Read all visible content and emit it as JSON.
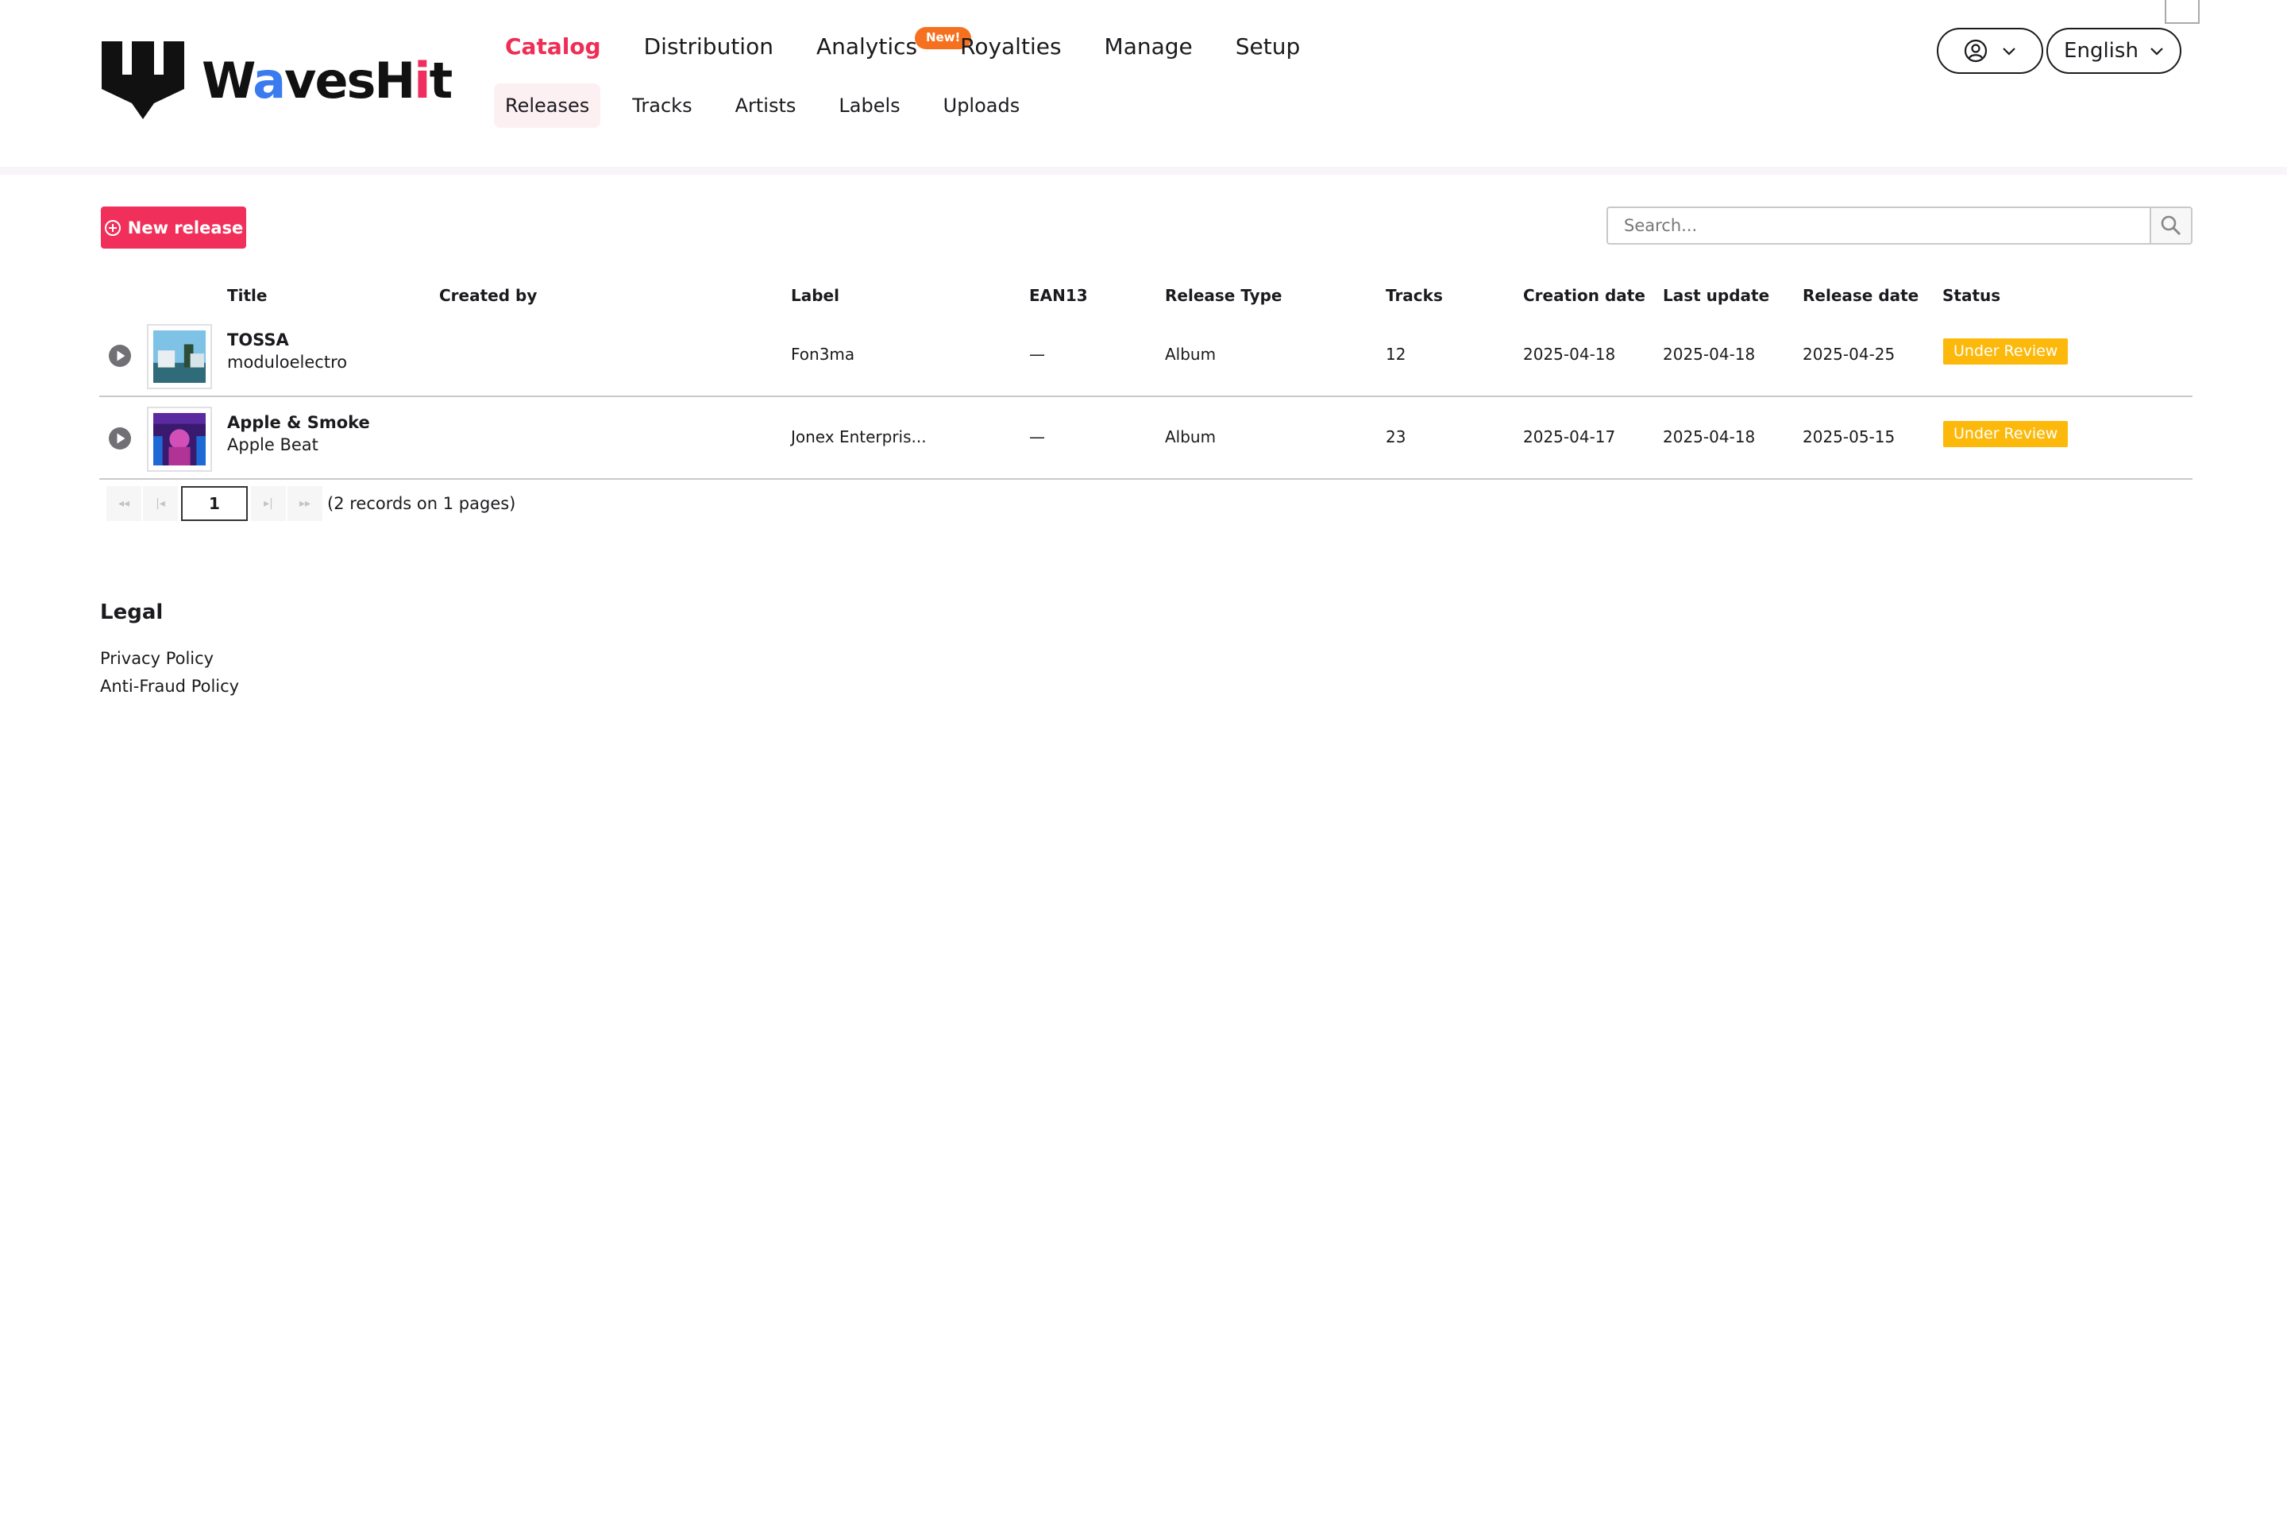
{
  "brand": {
    "name_prefix": "W",
    "name_o": "a",
    "name_mid": "vesH",
    "name_i": "i",
    "name_suffix": "t",
    "accent": "#ef2d55"
  },
  "nav": {
    "main": [
      {
        "label": "Catalog",
        "active": true
      },
      {
        "label": "Distribution"
      },
      {
        "label": "Analytics",
        "badge": "New!"
      },
      {
        "label": "Royalties"
      },
      {
        "label": "Manage"
      },
      {
        "label": "Setup"
      }
    ],
    "sub": [
      {
        "label": "Releases",
        "active": true
      },
      {
        "label": "Tracks"
      },
      {
        "label": "Artists"
      },
      {
        "label": "Labels"
      },
      {
        "label": "Uploads"
      }
    ]
  },
  "header": {
    "language": "English",
    "user_icon": "user-circle-icon"
  },
  "toolbar": {
    "new_release": "New release",
    "search_placeholder": "Search..."
  },
  "table": {
    "columns": [
      "Title",
      "Created by",
      "Label",
      "EAN13",
      "Release Type",
      "Tracks",
      "Creation date",
      "Last update",
      "Release date",
      "Status"
    ],
    "rows": [
      {
        "title": "TOSSA",
        "artist": "moduloelectro",
        "created_by": "",
        "label": "Fon3ma",
        "ean13": "—",
        "release_type": "Album",
        "tracks": "12",
        "creation_date": "2025-04-18",
        "last_update": "2025-04-18",
        "release_date": "2025-04-25",
        "status": "Under Review"
      },
      {
        "title": "Apple & Smoke",
        "artist": "Apple Beat",
        "created_by": "",
        "label": "Jonex Enterpris...",
        "ean13": "—",
        "release_type": "Album",
        "tracks": "23",
        "creation_date": "2025-04-17",
        "last_update": "2025-04-18",
        "release_date": "2025-05-15",
        "status": "Under Review"
      }
    ]
  },
  "pagination": {
    "first": "◂◂",
    "prev": "|◂",
    "current": "1",
    "next": "▸|",
    "last": "▸▸",
    "info": "(2 records on 1 pages)"
  },
  "footer": {
    "title": "Legal",
    "links": [
      "Privacy Policy",
      "Anti-Fraud Policy"
    ]
  },
  "colors": {
    "status": "#fcb90c",
    "new_badge": "#f5711f",
    "primary_button": "#f0305a"
  }
}
